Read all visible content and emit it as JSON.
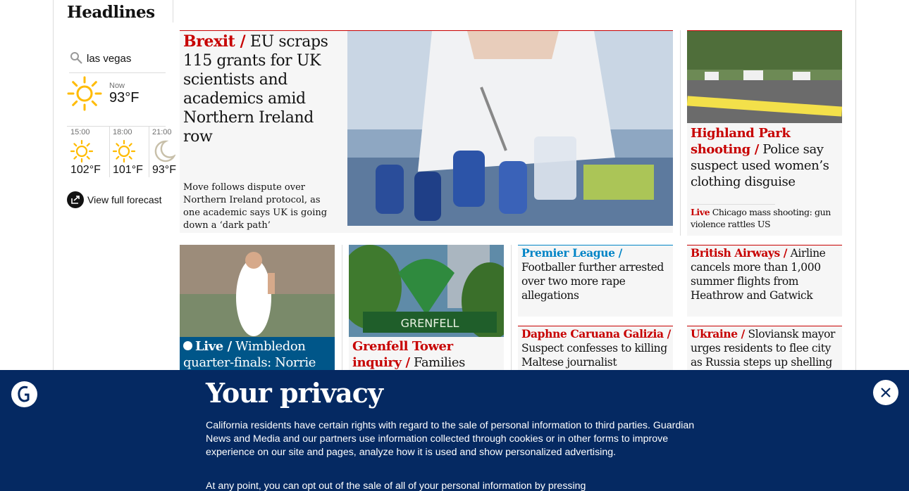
{
  "colors": {
    "news_red": "#c70000",
    "sport_blue": "#0084c6",
    "live_blue": "#005689",
    "banner_navy": "#052962",
    "sun_yellow": "#ffbb00"
  },
  "headlines": {
    "title": "Headlines"
  },
  "weather": {
    "location": "las vegas",
    "now_label": "Now",
    "now_temp": "93°F",
    "now_icon": "sun-icon",
    "hours": [
      {
        "time": "15:00",
        "temp": "102°F",
        "icon": "sun-icon"
      },
      {
        "time": "18:00",
        "temp": "101°F",
        "icon": "sun-icon"
      },
      {
        "time": "21:00",
        "temp": "93°F",
        "icon": "moon-icon"
      }
    ],
    "forecast_label": "View full forecast",
    "forecast_icon": "external-link-icon"
  },
  "stories": {
    "brexit": {
      "kicker": "Brexit /",
      "headline": " EU scraps 115 grants for UK scientists and academics amid Northern Ireland row",
      "standfirst": "Move follows dispute over Northern Ireland protocol, as one academic says UK is going down a ‘dark path’"
    },
    "highland": {
      "kicker": "Highland Park shooting /",
      "headline": " Police say suspect used women’s clothing disguise",
      "live_label": "Live",
      "sub": " Chicago mass shooting: gun violence rattles US"
    },
    "wimbledon": {
      "kicker": "Live /",
      "headline": " Wimbledon quarter-finals: Norrie"
    },
    "grenfell": {
      "kicker": "Grenfell Tower inquiry /",
      "headline": " Families"
    },
    "premier": {
      "kicker": "Premier League /",
      "headline": "Footballer further arrested over two more rape allegations"
    },
    "ba": {
      "kicker": "British Airways /",
      "headline": " Airline cancels more than 1,000 summer flights from Heathrow and Gatwick"
    },
    "daphne": {
      "kicker": "Daphne Caruana Galizia /",
      "headline": "Suspect confesses to killing Maltese journalist"
    },
    "ukraine": {
      "kicker": "Ukraine /",
      "headline": " Sloviansk mayor urges residents to flee city as Russia steps up shelling"
    }
  },
  "privacy": {
    "title": "Your privacy",
    "body": "California residents have certain rights with regard to the sale of personal information to third parties. Guardian News and Media and our partners use information collected through cookies or in other forms to improve experience on our site and pages, analyze how it is used and show personalized advertising.",
    "body2": "At any point, you can opt out of the sale of all of your personal information by pressing",
    "close_icon": "close-icon",
    "logo_icon": "guardian-logo-icon"
  }
}
